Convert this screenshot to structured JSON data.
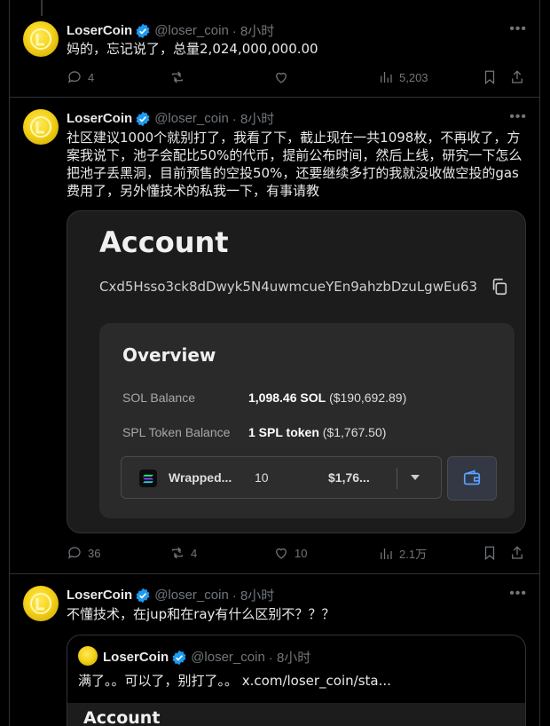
{
  "tweets": [
    {
      "author": "LoserCoin",
      "handle": "@loser_coin",
      "time": "· 8小时",
      "text": "妈的，忘记说了，总量2,024,000,000.00",
      "replies": "4",
      "retweets": "",
      "likes": "",
      "views": "5,203"
    },
    {
      "author": "LoserCoin",
      "handle": "@loser_coin",
      "time": "· 8小时",
      "text": "社区建议1000个就别打了，我看了下，截止现在一共1098枚，不再收了，方\n案我说下，池子会配比50%的代币，提前公布时间，然后上线，研究一下怎么\n把池子丢黑洞，目前预售的空投50%，还要继续多打的我就没收做空投的gas\n费用了，另外懂技术的私我一下，有事请教",
      "replies": "36",
      "retweets": "4",
      "likes": "10",
      "views": "2.1万",
      "card": {
        "title": "Account",
        "address": "Cxd5Hsso3ck8dDwyk5N4uwmcueYEn9ahzbDzuLgwEu63",
        "overview_title": "Overview",
        "sol_label": "SOL Balance",
        "sol_value": "1,098.46 SOL",
        "sol_usd": "($190,692.89)",
        "spl_label": "SPL Token Balance",
        "spl_value": "1 SPL token",
        "spl_usd": "($1,767.50)",
        "token_name": "Wrapped...",
        "token_amount": "10",
        "token_value": "$1,76..."
      }
    },
    {
      "author": "LoserCoin",
      "handle": "@loser_coin",
      "time": "· 8小时",
      "text": "不懂技术，在jup和在ray有什么区别不？？？",
      "quote": {
        "author": "LoserCoin",
        "handle": "@loser_coin",
        "time": "· 8小时",
        "text": "满了。。可以了，别打了。。 x.com/loser_coin/sta...",
        "image_title": "Account"
      }
    }
  ],
  "colors": {
    "verified": "#1d9bf0",
    "muted": "#71767b",
    "border": "#2f3336"
  }
}
